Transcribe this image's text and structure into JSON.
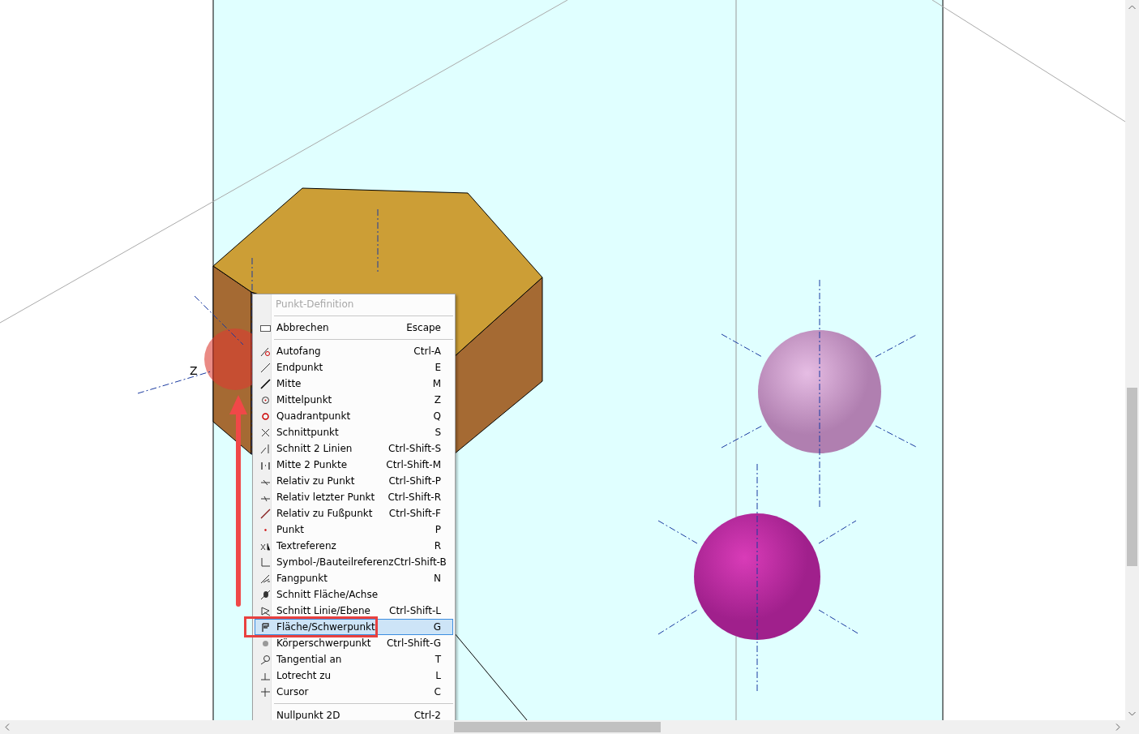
{
  "scene": {
    "axis_label": "Z"
  },
  "context_menu": {
    "entries": [
      {
        "kind": "header",
        "label": "Punkt-Definition"
      },
      {
        "kind": "separator"
      },
      {
        "kind": "item",
        "label": "Abbrechen",
        "shortcut": "Escape",
        "selected": false
      },
      {
        "kind": "separator"
      },
      {
        "kind": "item",
        "label": "Autofang",
        "shortcut": "Ctrl-A",
        "selected": false
      },
      {
        "kind": "item",
        "label": "Endpunkt",
        "shortcut": "E",
        "selected": false
      },
      {
        "kind": "item",
        "label": "Mitte",
        "shortcut": "M",
        "selected": false
      },
      {
        "kind": "item",
        "label": "Mittelpunkt",
        "shortcut": "Z",
        "selected": false
      },
      {
        "kind": "item",
        "label": "Quadrantpunkt",
        "shortcut": "Q",
        "selected": false
      },
      {
        "kind": "item",
        "label": "Schnittpunkt",
        "shortcut": "S",
        "selected": false
      },
      {
        "kind": "item",
        "label": "Schnitt 2 Linien",
        "shortcut": "Ctrl-Shift-S",
        "selected": false
      },
      {
        "kind": "item",
        "label": "Mitte 2 Punkte",
        "shortcut": "Ctrl-Shift-M",
        "selected": false
      },
      {
        "kind": "item",
        "label": "Relativ zu Punkt",
        "shortcut": "Ctrl-Shift-P",
        "selected": false
      },
      {
        "kind": "item",
        "label": "Relativ letzter Punkt",
        "shortcut": "Ctrl-Shift-R",
        "selected": false
      },
      {
        "kind": "item",
        "label": "Relativ zu Fußpunkt",
        "shortcut": "Ctrl-Shift-F",
        "selected": false
      },
      {
        "kind": "item",
        "label": "Punkt",
        "shortcut": "P",
        "selected": false
      },
      {
        "kind": "item",
        "label": "Textreferenz",
        "shortcut": "R",
        "selected": false
      },
      {
        "kind": "item",
        "label": "Symbol-/Bauteilreferenz",
        "shortcut": "Ctrl-Shift-B",
        "selected": false
      },
      {
        "kind": "item",
        "label": "Fangpunkt",
        "shortcut": "N",
        "selected": false
      },
      {
        "kind": "item",
        "label": "Schnitt Fläche/Achse",
        "selected": false
      },
      {
        "kind": "item",
        "label": "Schnitt Linie/Ebene",
        "shortcut": "Ctrl-Shift-L",
        "selected": false
      },
      {
        "kind": "item",
        "label": "Fläche/Schwerpunkt",
        "shortcut": "G",
        "selected": true
      },
      {
        "kind": "item",
        "label": "Körperschwerpunkt",
        "shortcut": "Ctrl-Shift-G",
        "selected": false
      },
      {
        "kind": "item",
        "label": "Tangential an",
        "shortcut": "T",
        "selected": false
      },
      {
        "kind": "item",
        "label": "Lotrecht zu",
        "shortcut": "L",
        "selected": false
      },
      {
        "kind": "item",
        "label": "Cursor",
        "shortcut": "C",
        "selected": false
      },
      {
        "kind": "separator"
      },
      {
        "kind": "item",
        "label": "Nullpunkt 2D",
        "shortcut": "Ctrl-2",
        "selected": false
      }
    ]
  }
}
